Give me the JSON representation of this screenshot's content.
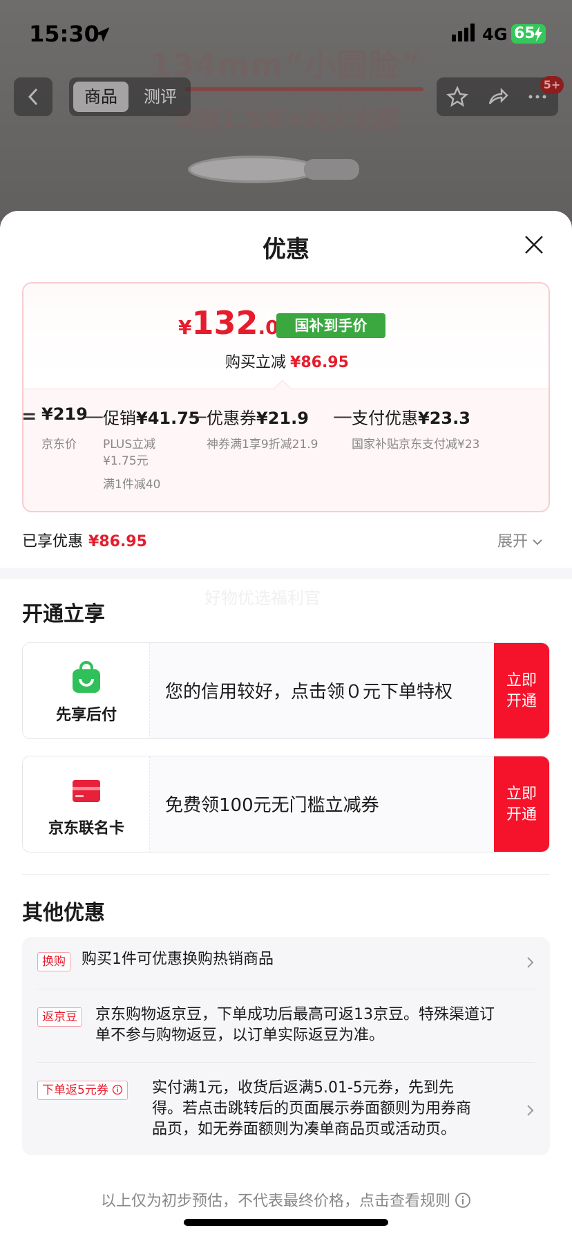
{
  "status_bar": {
    "time": "15:30",
    "network": "4G",
    "battery": "65"
  },
  "background": {
    "headline_1": "134mm“小圆脸”",
    "headline_2": "贡献1.5米+的大光照"
  },
  "nav": {
    "tabs": [
      {
        "label": "商品"
      },
      {
        "label": "测评"
      }
    ],
    "badge": "5+"
  },
  "sheet": {
    "title": "优惠",
    "price": {
      "currency": "¥",
      "integer": "132",
      "decimal": ".05",
      "tag": "国补到手价",
      "buy_reduce_label": "购买立减",
      "buy_reduce_amount": "¥86.95"
    },
    "calc": {
      "op_equals": "=",
      "op_minus": "—",
      "terms": [
        {
          "name": "",
          "value": "¥219",
          "sub": [
            "京东价"
          ]
        },
        {
          "name": "促销",
          "value": "¥41.75",
          "sub": [
            "PLUS立减",
            "¥1.75元",
            "满1件减40"
          ]
        },
        {
          "name": "优惠券",
          "value": "¥21.9",
          "sub": [
            "神券满1享9折减21.9"
          ]
        },
        {
          "name": "支付优惠",
          "value": "¥23.3",
          "sub": [
            "国家补贴京东支付减¥23"
          ]
        }
      ]
    },
    "enjoyed_label": "已享优惠",
    "enjoyed_amount": "¥86.95",
    "expand_label": "展开",
    "watermark": "好物优选福利官",
    "open_section_title": "开通立享",
    "offers": [
      {
        "label": "先享后付",
        "text": "您的信用较好，点击领０元下单特权",
        "button": [
          "立即",
          "开通"
        ],
        "icon": "shopping-bag-icon"
      },
      {
        "label": "京东联名卡",
        "text": "免费领100元无门槛立减券",
        "button": [
          "立即",
          "开通"
        ],
        "icon": "credit-card-icon"
      }
    ],
    "other_section_title": "其他优惠",
    "other_items": [
      {
        "tag": "换购",
        "lines": [
          "购买1件可优惠换购热销商品"
        ]
      },
      {
        "tag": "返京豆",
        "lines": [
          "京东购物返京豆，下单成功后最高可返13京豆。特殊渠道订",
          "单不参与购物返豆，以订单实际返豆为准。"
        ]
      },
      {
        "tag": "下单返5元券",
        "lines": [
          "实付满1元，收货后返满5.01-5元券，先到先",
          "得。若点击跳转后的页面展示券面额则为用券商",
          "品页，如无券面额则为凑单商品页或活动页。"
        ]
      }
    ],
    "footer_note": "以上仅为初步预估，不代表最终价格，点击查看规则",
    "colors": {
      "accent_red": "#e61c2c",
      "button_red": "#f5132b",
      "subsidy_green": "#3ba83f"
    }
  }
}
